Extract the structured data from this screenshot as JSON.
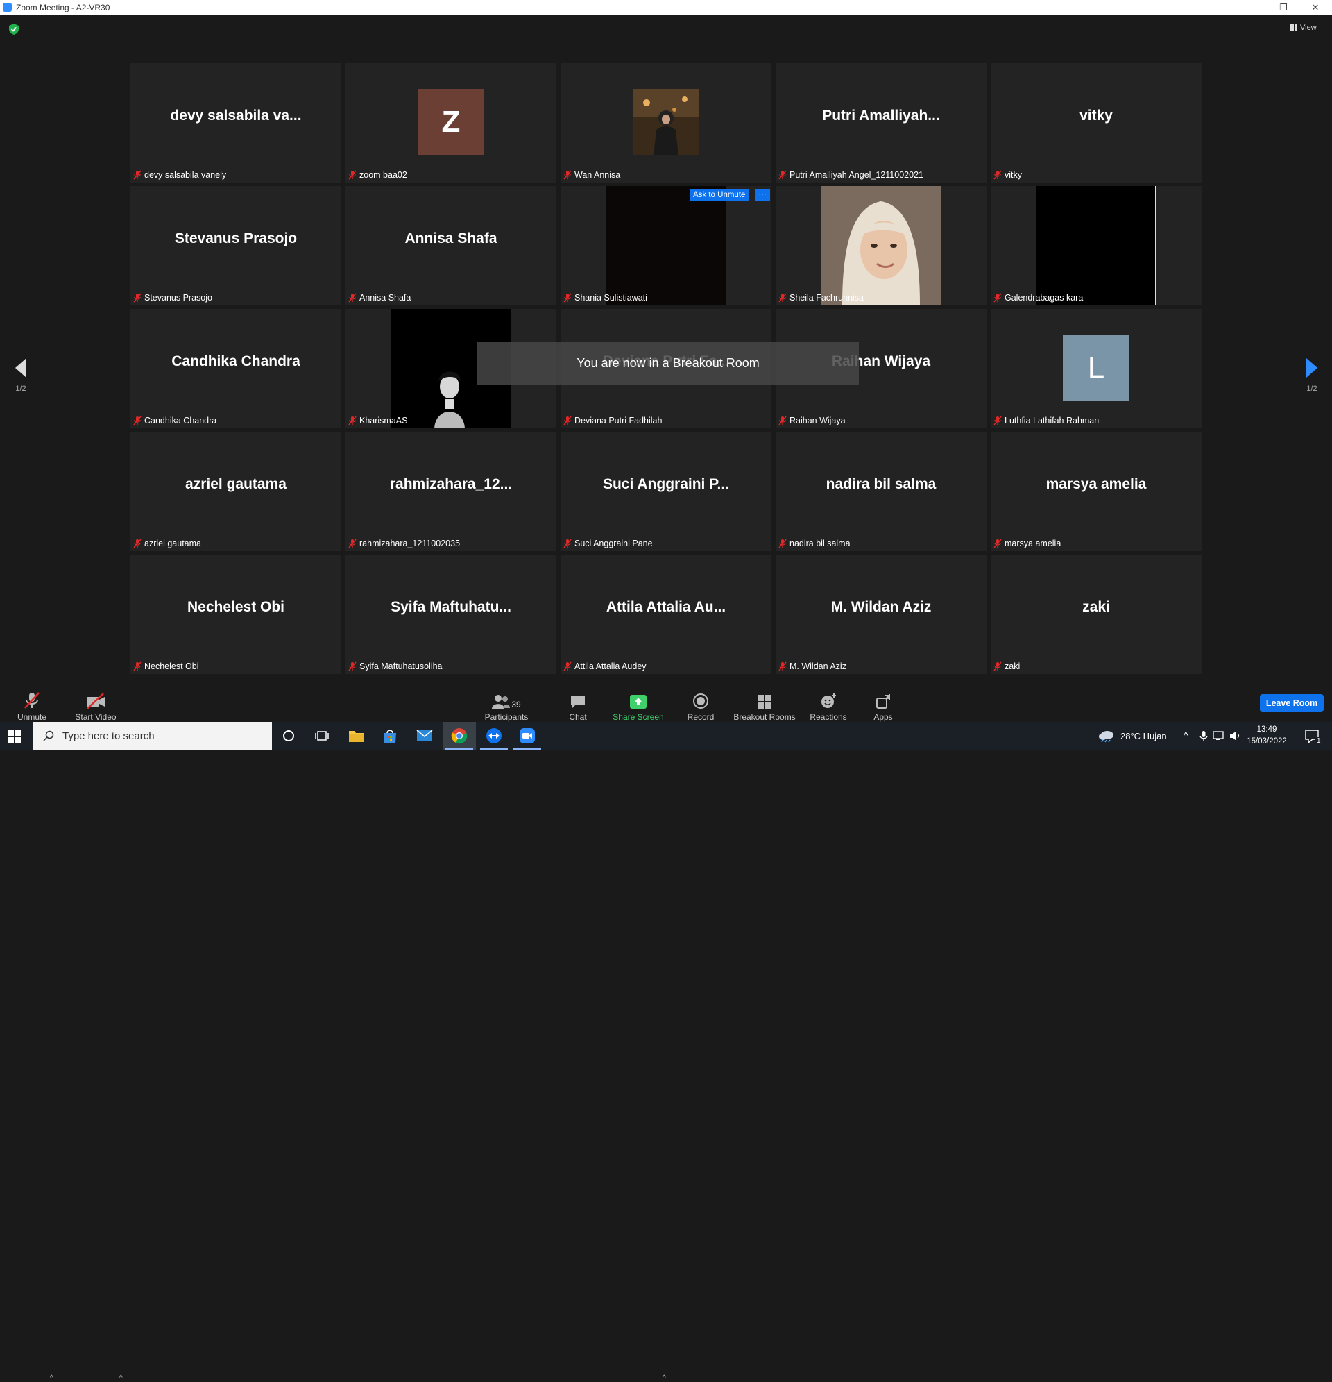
{
  "window": {
    "title": "Zoom Meeting - A2-VR30"
  },
  "topbar": {
    "view_label": "View"
  },
  "pagination": {
    "left": "1/2",
    "right": "1/2"
  },
  "ask_to_unmute_label": "Ask to Unmute",
  "more_label": "···",
  "breakout_toast": "You are now in a Breakout Room",
  "tiles": [
    {
      "display": "devy salsabila va...",
      "label": "devy salsabila vanely"
    },
    {
      "display": "Z",
      "label": "zoom baa02",
      "avatar_color": "#6b3f33"
    },
    {
      "display": "",
      "label": "Wan Annisa",
      "photo": "wan"
    },
    {
      "display": "Putri  Amalliyah...",
      "label": "Putri Amalliyah Angel_1211002021"
    },
    {
      "display": "vitky",
      "label": "vitky"
    },
    {
      "display": "Stevanus Prasojo",
      "label": "Stevanus Prasojo"
    },
    {
      "display": "Annisa Shafa",
      "label": "Annisa Shafa"
    },
    {
      "display": "",
      "label": "Shania Sulistiawati",
      "photo": "dark"
    },
    {
      "display": "",
      "label": "Sheila Fachrunnisa",
      "photo": "sheila"
    },
    {
      "display": "",
      "label": "Galendrabagas kara",
      "photo": "black"
    },
    {
      "display": "Candhika Chandra",
      "label": "Candhika Chandra"
    },
    {
      "display": "",
      "label": "KharismaAS",
      "photo": "kharisma"
    },
    {
      "display": "Deviana Putri Fa...",
      "label": "Deviana Putri Fadhilah"
    },
    {
      "display": "Raihan Wijaya",
      "label": "Raihan Wijaya"
    },
    {
      "display": "L",
      "label": "Luthfia Lathifah Rahman",
      "avatar_color": "#7a95a8"
    },
    {
      "display": "azriel gautama",
      "label": "azriel gautama"
    },
    {
      "display": "rahmizahara_12...",
      "label": "rahmizahara_1211002035"
    },
    {
      "display": "Suci Anggraini P...",
      "label": "Suci Anggraini Pane"
    },
    {
      "display": "nadira bil salma",
      "label": "nadira bil salma"
    },
    {
      "display": "marsya amelia",
      "label": "marsya amelia"
    },
    {
      "display": "Nechelest Obi",
      "label": "Nechelest Obi"
    },
    {
      "display": "Syifa  Maftuhatu...",
      "label": "Syifa Maftuhatusoliha"
    },
    {
      "display": "Attila Attalia Au...",
      "label": "Attila Attalia Audey"
    },
    {
      "display": "M. Wildan Aziz",
      "label": "M. Wildan Aziz"
    },
    {
      "display": "zaki",
      "label": "zaki"
    }
  ],
  "toolbar": {
    "unmute": "Unmute",
    "start_video": "Start Video",
    "participants": "Participants",
    "participants_count": "39",
    "chat": "Chat",
    "share_screen": "Share Screen",
    "record": "Record",
    "breakout_rooms": "Breakout Rooms",
    "reactions": "Reactions",
    "apps": "Apps",
    "leave_room": "Leave Room"
  },
  "taskbar": {
    "search_placeholder": "Type here to search",
    "weather": "28°C  Hujan",
    "time": "13:49",
    "date": "15/03/2022",
    "notification_count": "1"
  },
  "colors": {
    "accent": "#0e72ed",
    "share_green": "#3fd06c",
    "muted_red": "#e02828"
  }
}
